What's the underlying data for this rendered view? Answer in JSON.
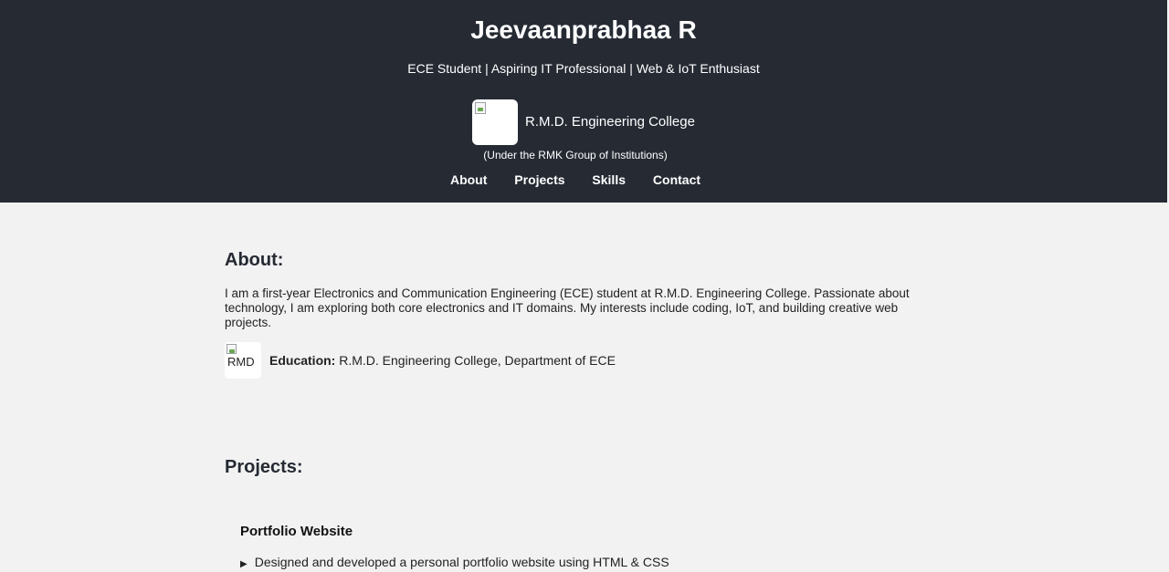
{
  "header": {
    "name": "Jeevaanprabhaa R",
    "tagline": "ECE Student | Aspiring IT Professional | Web & IoT Enthusiast",
    "college_name": "R.M.D. Engineering College",
    "college_sub": "(Under the RMK Group of Institutions)",
    "nav": [
      {
        "label": "About"
      },
      {
        "label": "Projects"
      },
      {
        "label": "Skills"
      },
      {
        "label": "Contact"
      }
    ]
  },
  "about": {
    "heading": "About:",
    "text": "I am a first-year Electronics and Communication Engineering (ECE) student at R.M.D. Engineering College. Passionate about technology, I am exploring both core electronics and IT domains. My interests include coding, IoT, and building creative web projects.",
    "education_label": "Education:",
    "education_value": " R.M.D. Engineering College, Department of ECE",
    "edu_logo_alt": "RMD"
  },
  "projects": {
    "heading": "Projects:",
    "items": [
      {
        "title": "Portfolio Website",
        "bullet": "▶",
        "description": "Designed and developed a personal portfolio website using HTML & CSS"
      }
    ]
  },
  "colors": {
    "header_bg": "#252a33",
    "page_bg": "#f2f2f2"
  }
}
